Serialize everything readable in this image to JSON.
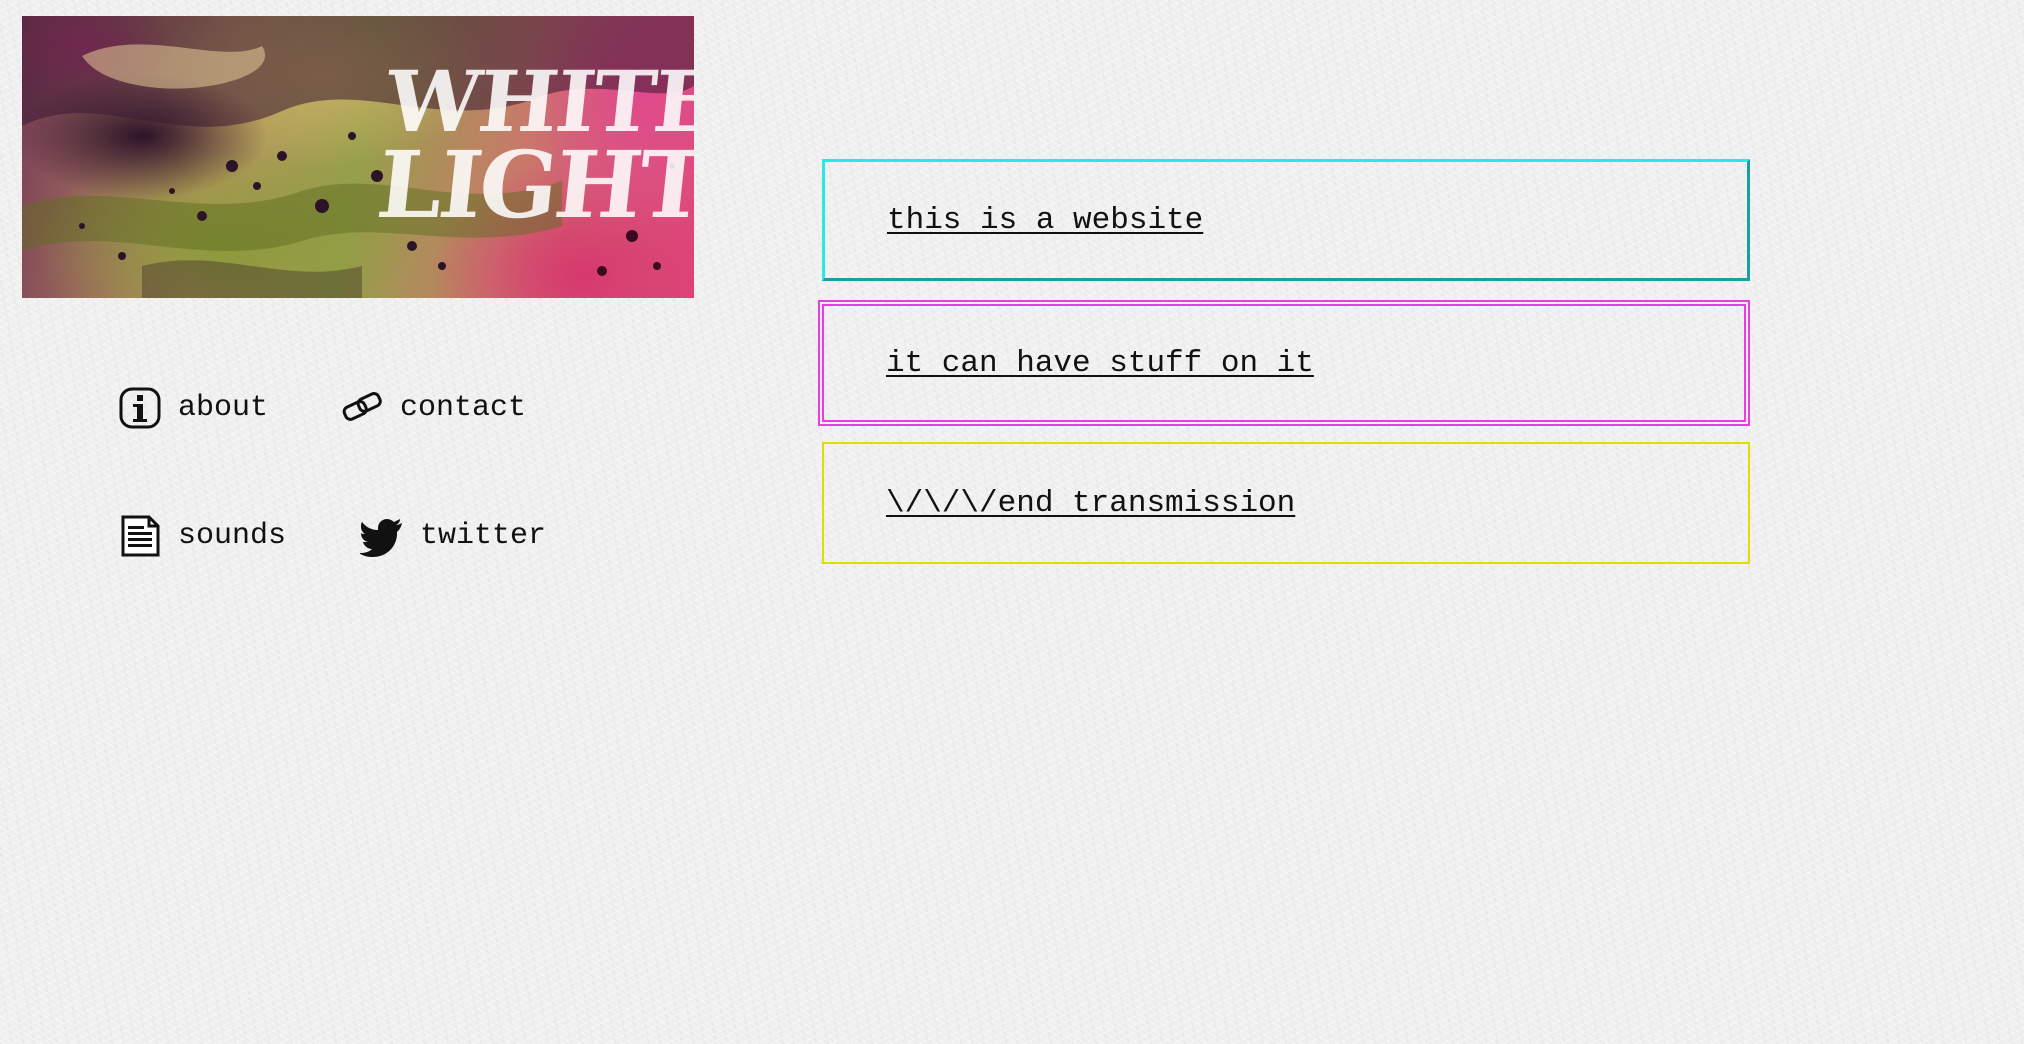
{
  "banner": {
    "logo_line1": "WHITE",
    "logo_line2": "LIGHT"
  },
  "nav": {
    "items": [
      {
        "label": "about",
        "icon": "info-icon"
      },
      {
        "label": "contact",
        "icon": "chain-link-icon"
      },
      {
        "label": "sounds",
        "icon": "document-icon"
      },
      {
        "label": "twitter",
        "icon": "twitter-bird-icon"
      }
    ]
  },
  "links": [
    {
      "label": "this is a website",
      "border_color": "#29e8e8"
    },
    {
      "label": "it can have stuff on it",
      "border_color": "#e43ee4"
    },
    {
      "label": "\\/\\/\\/end transmission",
      "border_color": "#dede00"
    }
  ]
}
